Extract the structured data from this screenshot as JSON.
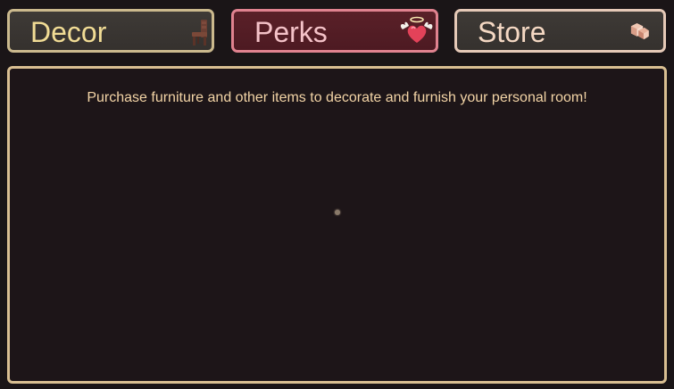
{
  "tabs": [
    {
      "label": "Decor",
      "icon": "chair-icon"
    },
    {
      "label": "Perks",
      "icon": "winged-heart-icon"
    },
    {
      "label": "Store",
      "icon": "gem-icon"
    }
  ],
  "panel": {
    "description": "Purchase furniture and other items to decorate and furnish your personal room!"
  },
  "colors": {
    "background": "#1a1517",
    "decor_border": "#cbb98d",
    "perks_border": "#e0828f",
    "store_border": "#e5c9b7",
    "panel_border": "#d9bf92",
    "description_text": "#f3d4a6"
  }
}
